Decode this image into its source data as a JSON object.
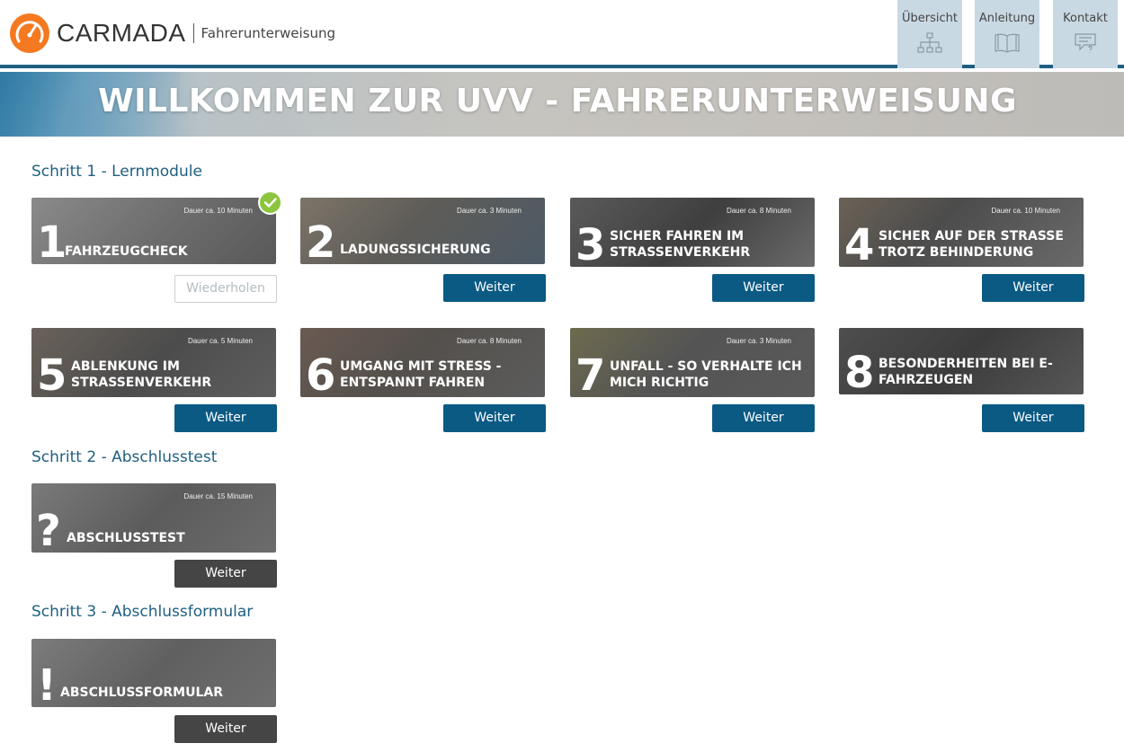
{
  "brand": {
    "name": "CARMADA",
    "subtitle": "Fahrerunterweisung"
  },
  "nav": [
    {
      "label": "Übersicht",
      "icon": "sitemap-icon"
    },
    {
      "label": "Anleitung",
      "icon": "book-icon"
    },
    {
      "label": "Kontakt",
      "icon": "chat-icon"
    }
  ],
  "banner": {
    "title": "WILLKOMMEN ZUR UVV - FAHRERUNTERWEISUNG"
  },
  "sections": [
    {
      "title": "Schritt 1 - Lernmodule"
    },
    {
      "title": "Schritt 2 - Abschlusstest"
    },
    {
      "title": "Schritt 3 - Abschlussformular"
    }
  ],
  "modules": [
    {
      "num": "1",
      "title": "FAHRZEUGCHECK",
      "duration": "Dauer ca. 10 Minuten",
      "button": "Wiederholen",
      "completed": true
    },
    {
      "num": "2",
      "title": "LADUNGSSICHERUNG",
      "duration": "Dauer ca. 3 Minuten",
      "button": "Weiter",
      "completed": false
    },
    {
      "num": "3",
      "title_l1": "SICHER FAHREN IM",
      "title_l2": "STRASSENVERKEHR",
      "duration": "Dauer ca. 8 Minuten",
      "button": "Weiter",
      "completed": false
    },
    {
      "num": "4",
      "title_l1": "SICHER AUF DER STRASSE",
      "title_l2": "TROTZ BEHINDERUNG",
      "duration": "Dauer ca. 10 Minuten",
      "button": "Weiter",
      "completed": false
    },
    {
      "num": "5",
      "title_l1": "ABLENKUNG IM",
      "title_l2": "STRASSENVERKEHR",
      "duration": "Dauer ca. 5 Minuten",
      "button": "Weiter",
      "completed": false
    },
    {
      "num": "6",
      "title_l1": "UMGANG MIT STRESS -",
      "title_l2": "ENTSPANNT FAHREN",
      "duration": "Dauer ca. 8 Minuten",
      "button": "Weiter",
      "completed": false
    },
    {
      "num": "7",
      "title_l1": "UNFALL - SO VERHALTE ICH",
      "title_l2": "MICH RICHTIG",
      "duration": "Dauer ca. 3 Minuten",
      "button": "Weiter",
      "completed": false
    },
    {
      "num": "8",
      "title_l1": "BESONDERHEITEN BEI E-",
      "title_l2": "FAHRZEUGEN",
      "duration": "",
      "button": "Weiter",
      "completed": false
    }
  ],
  "test": {
    "num": "?",
    "title": "ABSCHLUSSTEST",
    "duration": "Dauer ca. 15 Minuten",
    "button": "Weiter"
  },
  "form": {
    "num": "!",
    "title": "ABSCHLUSSFORMULAR",
    "button": "Weiter"
  },
  "colors": {
    "brand_orange": "#f47920",
    "primary_blue": "#0a5a84",
    "heading_blue": "#1f5f82",
    "nav_bg": "#c9d9e3",
    "check_green": "#8cc63f",
    "dark_button": "#454545"
  }
}
